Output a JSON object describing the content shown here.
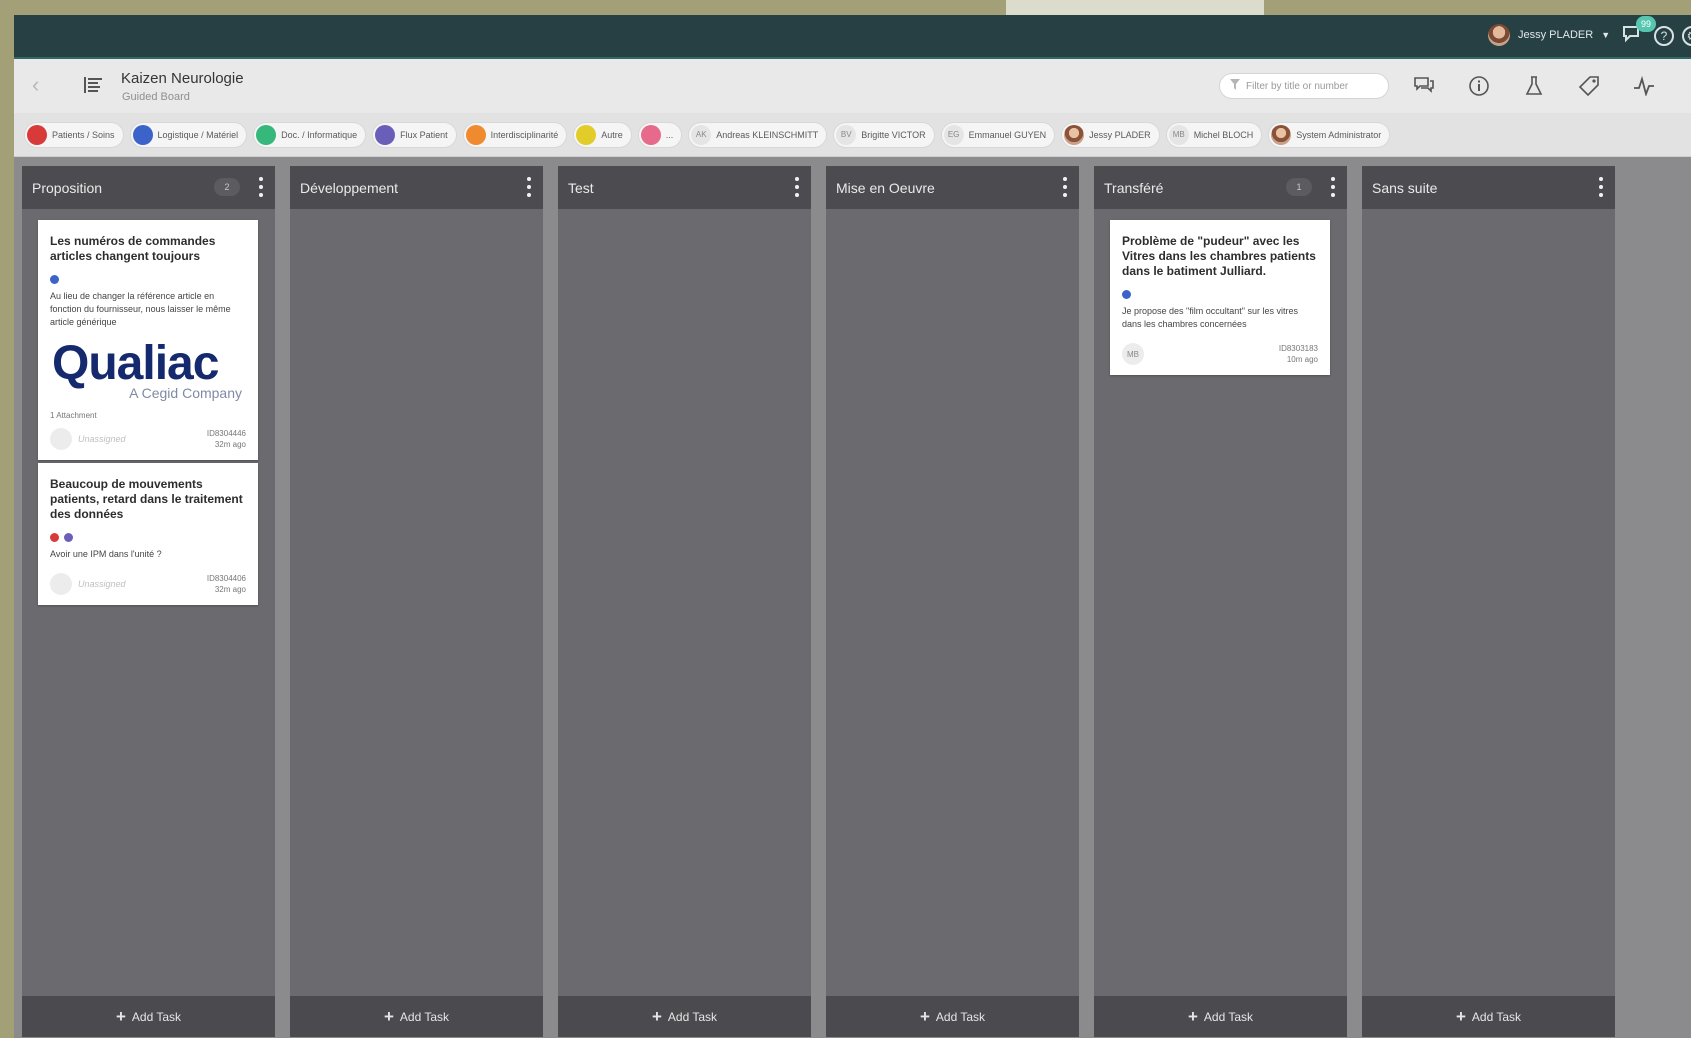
{
  "topbar": {
    "user_name": "Jessy PLADER",
    "chat_badge": "99"
  },
  "toolbar": {
    "title": "Kaizen Neurologie",
    "subtitle": "Guided Board",
    "filter_placeholder": "Filter by title or number"
  },
  "filters": [
    {
      "kind": "category",
      "color": "#d83a3a",
      "label": "Patients / Soins"
    },
    {
      "kind": "category",
      "color": "#3c63c9",
      "label": "Logistique / Matériel"
    },
    {
      "kind": "category",
      "color": "#36b77b",
      "label": "Doc. / Informatique"
    },
    {
      "kind": "category",
      "color": "#6a5fb8",
      "label": "Flux Patient"
    },
    {
      "kind": "category",
      "color": "#f08a2e",
      "label": "Interdisciplinarité"
    },
    {
      "kind": "category",
      "color": "#e2cc2a",
      "label": "Autre"
    },
    {
      "kind": "category",
      "color": "#e76a8c",
      "label": "..."
    },
    {
      "kind": "initials",
      "initials": "AK",
      "label": "Andreas KLEINSCHMITT"
    },
    {
      "kind": "initials",
      "initials": "BV",
      "label": "Brigitte VICTOR"
    },
    {
      "kind": "initials",
      "initials": "EG",
      "label": "Emmanuel GUYEN"
    },
    {
      "kind": "photo",
      "label": "Jessy PLADER"
    },
    {
      "kind": "initials",
      "initials": "MB",
      "label": "Michel BLOCH"
    },
    {
      "kind": "photo",
      "label": "System Administrator"
    }
  ],
  "board": {
    "add_task_label": "Add Task",
    "columns": [
      {
        "title": "Proposition",
        "count": "2"
      },
      {
        "title": "Développement",
        "count": ""
      },
      {
        "title": "Test",
        "count": ""
      },
      {
        "title": "Mise en Oeuvre",
        "count": ""
      },
      {
        "title": "Transféré",
        "count": "1"
      },
      {
        "title": "Sans suite",
        "count": ""
      }
    ]
  },
  "cards": {
    "c1": {
      "title": "Les numéros de commandes articles changent toujours",
      "tags": [
        "#3c63c9"
      ],
      "description": "Au lieu de changer la référence article en fonction du fournisseur, nous laisser le même article générique",
      "logo_main": "Qualiac",
      "logo_sub": "A Cegid Company",
      "attachments": "1 Attachment",
      "assignee": "Unassigned",
      "id": "ID8304446",
      "age": "32m ago"
    },
    "c2": {
      "title": "Beaucoup de mouvements patients, retard dans le traitement des données",
      "tags": [
        "#d83a3a",
        "#6a5fb8"
      ],
      "description": "Avoir une IPM dans l'unité ?",
      "assignee": "Unassigned",
      "id": "ID8304406",
      "age": "32m ago"
    },
    "c3": {
      "title": "Problème de \"pudeur\" avec les Vitres dans les chambres patients dans le batiment Julliard.",
      "tags": [
        "#3c63c9"
      ],
      "description": "Je propose des \"film occultant\" sur les vitres dans les chambres concernées",
      "assignee_initials": "MB",
      "id": "ID8303183",
      "age": "10m ago"
    }
  }
}
